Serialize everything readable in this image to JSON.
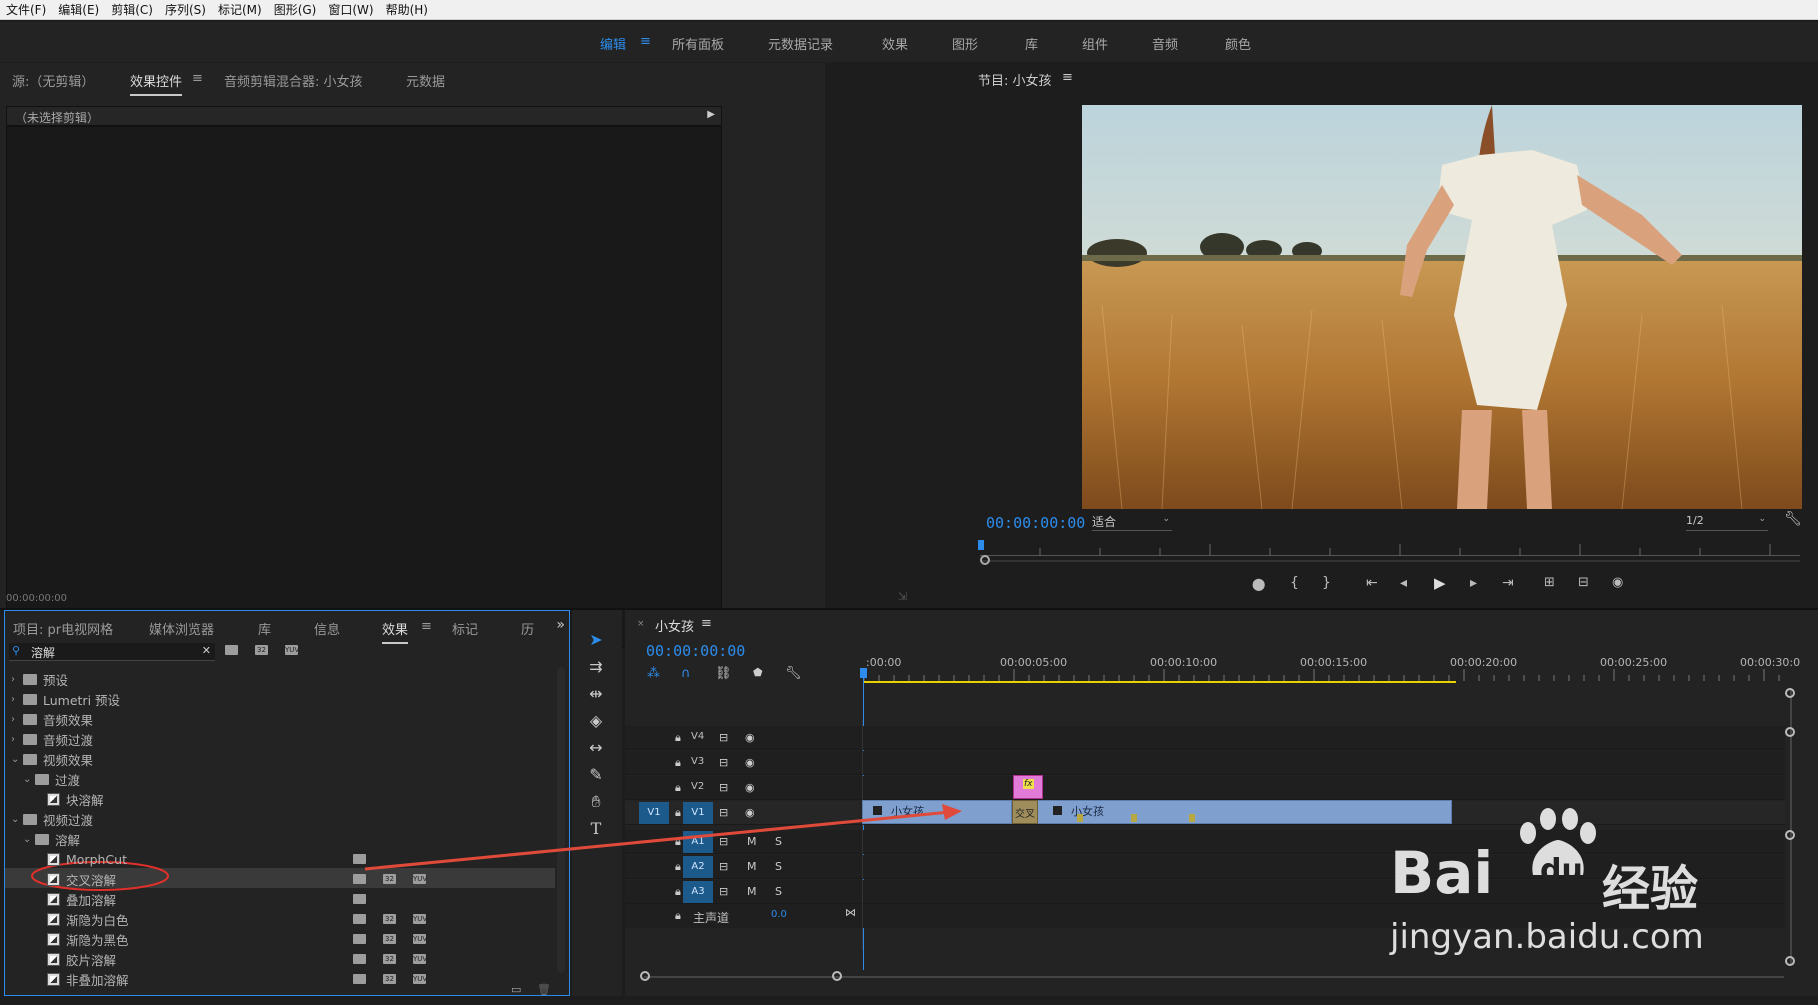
{
  "menubar": {
    "items": [
      "文件(F)",
      "编辑(E)",
      "剪辑(C)",
      "序列(S)",
      "标记(M)",
      "图形(G)",
      "窗口(W)",
      "帮助(H)"
    ]
  },
  "workspaces": {
    "items": [
      "编辑",
      "所有面板",
      "元数据记录",
      "效果",
      "图形",
      "库",
      "组件",
      "音频",
      "颜色"
    ],
    "active": "编辑"
  },
  "source_panel": {
    "tabs": [
      "源:（无剪辑）",
      "效果控件",
      "音频剪辑混合器: 小女孩",
      "元数据"
    ],
    "active_tab": "效果控件",
    "header": "（未选择剪辑）",
    "timecode": "00:00:00:00"
  },
  "program_panel": {
    "title": "节目: 小女孩",
    "timecode": "00:00:00:00",
    "fit": "适合",
    "resolution": "1/2"
  },
  "project_panel": {
    "tabs": [
      "项目: pr电视网格",
      "媒体浏览器",
      "库",
      "信息",
      "效果",
      "标记",
      "历"
    ],
    "active_tab": "效果",
    "search_value": "溶解",
    "tree": [
      {
        "label": "预设",
        "indent": 0,
        "type": "folder",
        "arrow": "›"
      },
      {
        "label": "Lumetri 预设",
        "indent": 0,
        "type": "folder",
        "arrow": "›"
      },
      {
        "label": "音频效果",
        "indent": 0,
        "type": "folder",
        "arrow": "›"
      },
      {
        "label": "音频过渡",
        "indent": 0,
        "type": "folder",
        "arrow": "›"
      },
      {
        "label": "视频效果",
        "indent": 0,
        "type": "folder",
        "arrow": "⌄"
      },
      {
        "label": "过渡",
        "indent": 1,
        "type": "folder",
        "arrow": "⌄"
      },
      {
        "label": "块溶解",
        "indent": 2,
        "type": "effect",
        "arrow": ""
      },
      {
        "label": "视频过渡",
        "indent": 0,
        "type": "folder",
        "arrow": "⌄"
      },
      {
        "label": "溶解",
        "indent": 1,
        "type": "folder",
        "arrow": "⌄"
      },
      {
        "label": "MorphCut",
        "indent": 2,
        "type": "effect",
        "arrow": ""
      },
      {
        "label": "交叉溶解",
        "indent": 2,
        "type": "effect",
        "arrow": ""
      },
      {
        "label": "叠加溶解",
        "indent": 2,
        "type": "effect",
        "arrow": ""
      },
      {
        "label": "渐隐为白色",
        "indent": 2,
        "type": "effect",
        "arrow": ""
      },
      {
        "label": "渐隐为黑色",
        "indent": 2,
        "type": "effect",
        "arrow": ""
      },
      {
        "label": "胶片溶解",
        "indent": 2,
        "type": "effect",
        "arrow": ""
      },
      {
        "label": "非叠加溶解",
        "indent": 2,
        "type": "effect",
        "arrow": ""
      }
    ]
  },
  "timeline": {
    "sequence": "小女孩",
    "timecode": "00:00:00:00",
    "ruler": [
      ":00:00",
      "00:00:05:00",
      "00:00:10:00",
      "00:00:15:00",
      "00:00:20:00",
      "00:00:25:00",
      "00:00:30:0"
    ],
    "video_tracks": [
      "V4",
      "V3",
      "V2",
      "V1"
    ],
    "audio_tracks": [
      "A1",
      "A2",
      "A3"
    ],
    "master_label": "主声道",
    "master_value": "0.0",
    "clip_name": "小女孩",
    "transition_label": "交叉",
    "fx_label": "fx",
    "source_patch": "V1",
    "mute": "M",
    "solo": "S"
  },
  "watermark": {
    "logo": "Bai",
    "logo2": "du",
    "brand": "经验",
    "url": "jingyan.baidu.com"
  }
}
